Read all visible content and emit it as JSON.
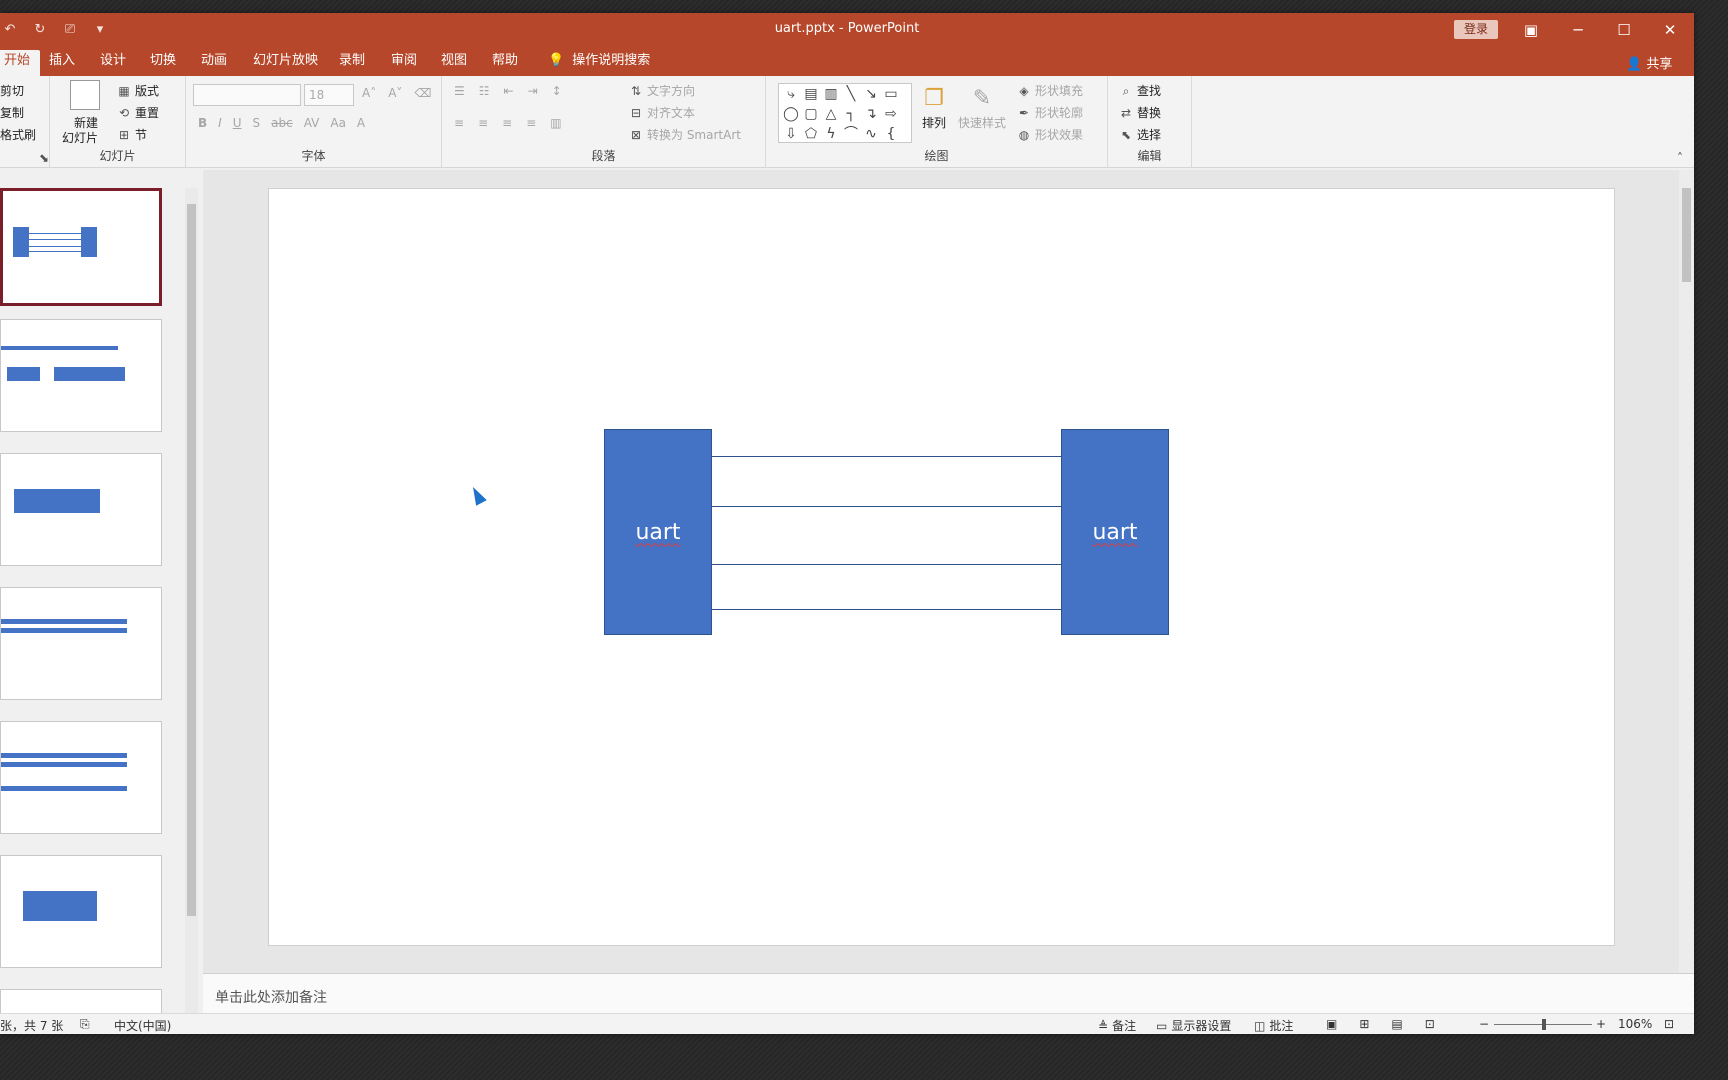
{
  "window": {
    "title": "uart.pptx  -  PowerPoint",
    "login_label": "登录",
    "share_label": "共享"
  },
  "tabs": [
    "开始",
    "插入",
    "设计",
    "切换",
    "动画",
    "幻灯片放映",
    "录制",
    "审阅",
    "视图",
    "帮助"
  ],
  "tell_me": "操作说明搜索",
  "ribbon": {
    "clipboard": {
      "cut": "剪切",
      "copy": "复制",
      "format_painter": "格式刷"
    },
    "slides": {
      "new_slide_1": "新建",
      "new_slide_2": "幻灯片",
      "layout": "版式",
      "reset": "重置",
      "section": "节",
      "label": "幻灯片"
    },
    "font": {
      "font_size": "18",
      "label": "字体"
    },
    "paragraph": {
      "text_direction": "文字方向",
      "align_text": "对齐文本",
      "smartart": "转换为 SmartArt",
      "label": "段落"
    },
    "drawing": {
      "arrange": "排列",
      "quick_styles": "快速样式",
      "shape_fill": "形状填充",
      "shape_outline": "形状轮廓",
      "shape_effects": "形状效果",
      "label": "绘图"
    },
    "editing": {
      "find": "查找",
      "replace": "替换",
      "select": "选择",
      "label": "编辑"
    }
  },
  "slide": {
    "left_box": "uart",
    "right_box": "uart",
    "line_count": 4
  },
  "notes_placeholder": "单击此处添加备注",
  "status": {
    "slide_info": "张，共 7 张",
    "language": "中文(中国)",
    "notes": "备注",
    "display_settings": "显示器设置",
    "comments": "批注",
    "zoom": "106%"
  },
  "colors": {
    "accent": "#b7472a",
    "shape_fill": "#4472c4"
  }
}
